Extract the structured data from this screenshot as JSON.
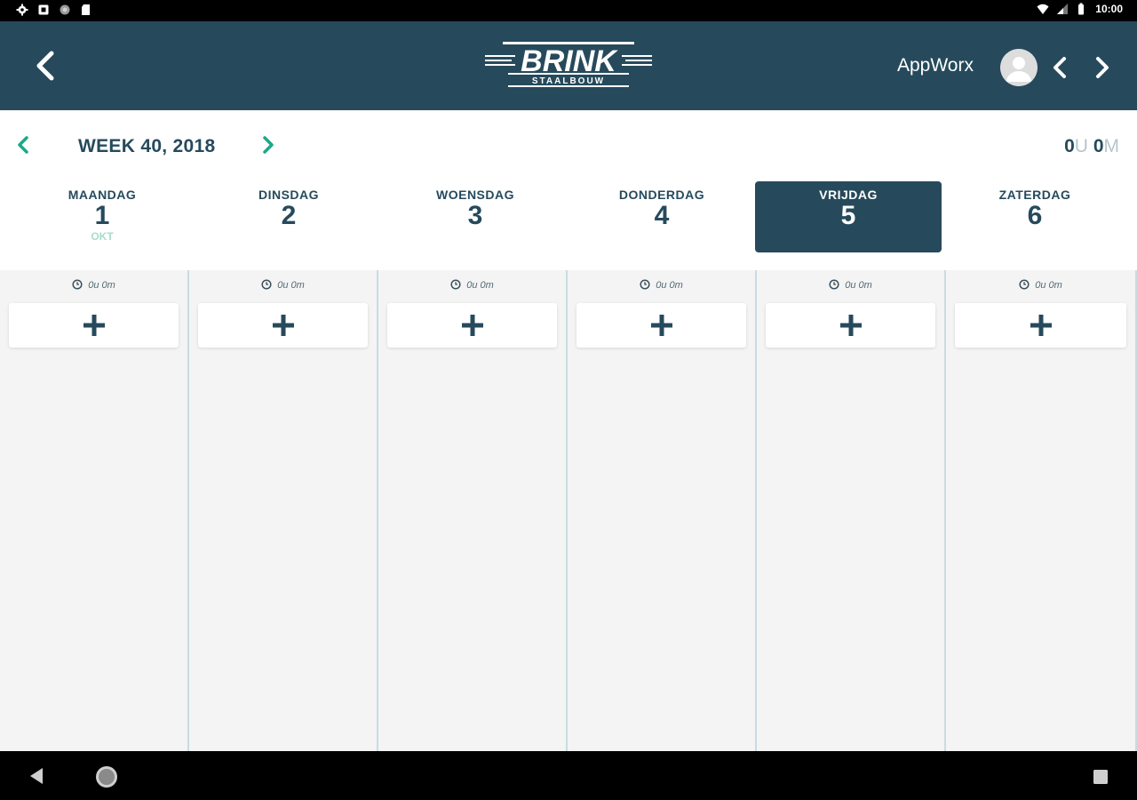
{
  "status_bar": {
    "time": "10:00",
    "icons": [
      "settings-icon",
      "notification-icon",
      "circle-icon",
      "sd-card-icon",
      "wifi-icon",
      "signal-icon",
      "battery-icon"
    ]
  },
  "header": {
    "logo_text": "BRINK",
    "logo_subtext": "STAALBOUW",
    "user_name": "AppWorx",
    "icons": [
      "back-arrow-icon",
      "avatar-icon",
      "chevron-left-icon",
      "chevron-right-icon"
    ]
  },
  "week": {
    "label": "WEEK 40, 2018",
    "total": {
      "hours": "0",
      "hours_unit": "U",
      "minutes": "0",
      "minutes_unit": "M"
    }
  },
  "days": [
    {
      "name": "MAANDAG",
      "number": "1",
      "month": "OKT",
      "active": false,
      "duration": "0u 0m"
    },
    {
      "name": "DINSDAG",
      "number": "2",
      "month": "",
      "active": false,
      "duration": "0u 0m"
    },
    {
      "name": "WOENSDAG",
      "number": "3",
      "month": "",
      "active": false,
      "duration": "0u 0m"
    },
    {
      "name": "DONDERDAG",
      "number": "4",
      "month": "",
      "active": false,
      "duration": "0u 0m"
    },
    {
      "name": "VRIJDAG",
      "number": "5",
      "month": "",
      "active": true,
      "duration": "0u 0m"
    },
    {
      "name": "ZATERDAG",
      "number": "6",
      "month": "",
      "active": false,
      "duration": "0u 0m"
    }
  ],
  "colors": {
    "primary": "#264a5c",
    "accent": "#1aa88a",
    "muted_unit": "#b8c5cc",
    "month_label": "#a7dccd",
    "board_bg": "#f4f4f4",
    "column_divider": "#c9dbe3"
  },
  "nav_bar": {
    "icons": [
      "nav-back-icon",
      "nav-home-icon",
      "nav-recents-icon"
    ]
  }
}
